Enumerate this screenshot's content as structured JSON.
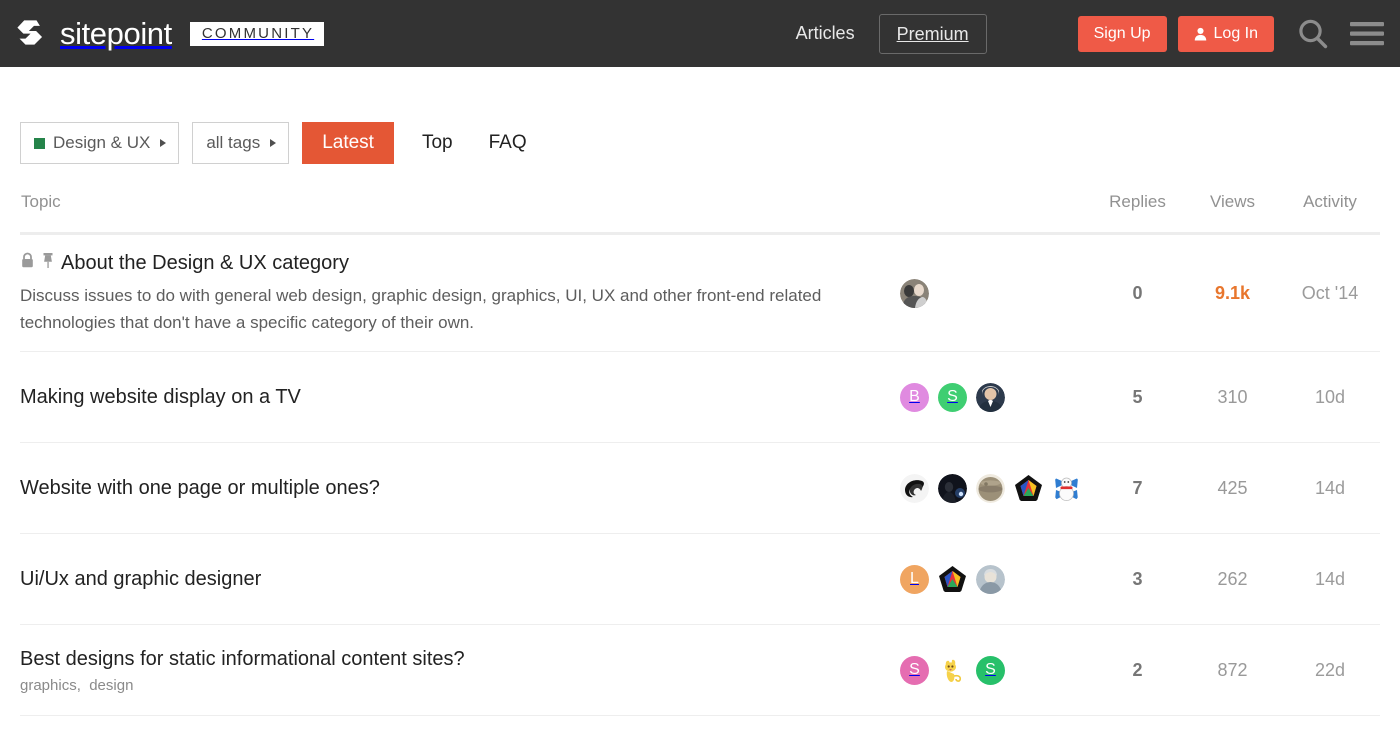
{
  "header": {
    "logo_mark": "sitepoint-logo-icon",
    "logo_word": "sitepoint",
    "logo_badge": "COMMUNITY",
    "articles_label": "Articles",
    "premium_label": "Premium",
    "signup_label": "Sign Up",
    "login_label": "Log In",
    "search_icon": "search-icon",
    "menu_icon": "hamburger-menu-icon",
    "bg_color": "#333333",
    "accent_color": "#ef5a47"
  },
  "filters": {
    "category_label": "Design & UX",
    "category_color": "#25844a",
    "tags_label": "all tags",
    "latest_label": "Latest",
    "latest_color": "#e45735",
    "top_label": "Top",
    "faq_label": "FAQ"
  },
  "table": {
    "headers": {
      "topic": "Topic",
      "replies": "Replies",
      "views": "Views",
      "activity": "Activity"
    },
    "rows": [
      {
        "title": "About the Design & UX category",
        "lock_icon": "lock-icon",
        "pin_icon": "pin-icon",
        "excerpt": "Discuss issues to do with general web design, graphic design, graphics, UI, UX and other front-end related technologies that don't have a specific category of their own.",
        "tags": [],
        "posters": [
          {
            "type": "image",
            "name": "avatar-photo-couple"
          }
        ],
        "replies": "0",
        "views": "9.1k",
        "views_hot": true,
        "activity": "Oct '14"
      },
      {
        "title": "Making website display on a TV",
        "excerpt": "",
        "tags": [],
        "posters": [
          {
            "type": "letter",
            "letter": "B",
            "color": "#e08ae0"
          },
          {
            "type": "letter",
            "letter": "S",
            "color": "#3fce72"
          },
          {
            "type": "image",
            "name": "avatar-photo-suit"
          }
        ],
        "replies": "5",
        "views": "310",
        "views_hot": false,
        "activity": "10d"
      },
      {
        "title": "Website with one page or multiple ones?",
        "excerpt": "",
        "tags": [],
        "posters": [
          {
            "type": "image",
            "name": "avatar-swirl"
          },
          {
            "type": "image",
            "name": "avatar-dark-photo"
          },
          {
            "type": "image",
            "name": "avatar-sphere"
          },
          {
            "type": "image",
            "name": "avatar-pentagon-star"
          },
          {
            "type": "image",
            "name": "avatar-snowman"
          }
        ],
        "replies": "7",
        "views": "425",
        "views_hot": false,
        "activity": "14d"
      },
      {
        "title": "Ui/Ux and graphic designer",
        "excerpt": "",
        "tags": [],
        "posters": [
          {
            "type": "letter",
            "letter": "L",
            "color": "#f0a561"
          },
          {
            "type": "image",
            "name": "avatar-pentagon-star"
          },
          {
            "type": "image",
            "name": "avatar-grey-photo"
          }
        ],
        "replies": "3",
        "views": "262",
        "views_hot": false,
        "activity": "14d"
      },
      {
        "title": "Best designs for static informational content sites?",
        "excerpt": "",
        "tags": [
          "graphics",
          "design"
        ],
        "posters": [
          {
            "type": "letter",
            "letter": "S",
            "color": "#e56db1"
          },
          {
            "type": "image",
            "name": "avatar-yellow-cat"
          },
          {
            "type": "letter",
            "letter": "S",
            "color": "#27c06a"
          }
        ],
        "replies": "2",
        "views": "872",
        "views_hot": false,
        "activity": "22d"
      }
    ]
  }
}
